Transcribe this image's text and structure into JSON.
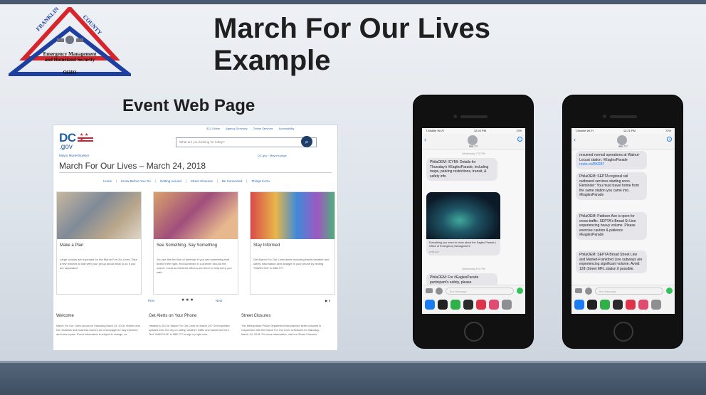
{
  "slide": {
    "title": "March For Our Lives Example",
    "section_label": "Event Web Page"
  },
  "logo": {
    "arc_top": "FRANKLIN",
    "arc_right": "COUNTY",
    "line1": "Emergency Management",
    "line2": "and Homeland Security",
    "state": "OHIO",
    "colors": {
      "red": "#d6262b",
      "blue": "#1f3fa0"
    }
  },
  "web": {
    "brand": "DC",
    "brand_sub": ".gov",
    "top_links": [
      "311 Online",
      "Agency Directory",
      "Online Services",
      "Accessibility"
    ],
    "search_placeholder": "What are you looking for today?",
    "breadcrumb": "Mayor Muriel Bowser",
    "sub_links": "DC.gov  ·  Mayor's page",
    "page_title": "March For Our Lives – March 24, 2018",
    "nav": [
      "Home",
      "Know Before You Go",
      "Getting Around",
      "Street Closures",
      "Be Connected",
      "Things to Do"
    ],
    "cards": [
      {
        "title": "Make a Plan",
        "body": "Large crowds are expected for the March For Our Lives. Take a few minutes to talk with your group about what to do if you are separated."
      },
      {
        "title": "See Something, Say Something",
        "body": "You are the first line of defense! If you see something that doesn't feel right, find someone in a uniform around the march. Local and federal officers are there to help keep you safe."
      },
      {
        "title": "Stay Informed",
        "body": "Get March For Our Lives alerts including timely weather and safety information sent straight to your phone by texting \"MARCH18\" to 888-777."
      }
    ],
    "pager": {
      "prev": "Prev",
      "next": "Next",
      "ctrl": "▶ II"
    },
    "columns": [
      {
        "heading": "Welcome",
        "text": "March For Our Lives occurs on Saturday March 24, 2018. Visitors and DC residents and business owners are encouraged to stay informed and have a plan. Event information is subject to change, so"
      },
      {
        "heading": "Get Alerts on Your Phone",
        "text": "Headed to DC for March For Our Lives on March 24? Get important updates from the city on safety, weather, traffic and transit info here. Text \"MARCH18\" to 888-777 to sign up right now."
      },
      {
        "heading": "Street Closures",
        "text": "The Metropolitan Police Department has planned street closures in conjunction with the March For Our Lives scheduled for Saturday, March 24, 2018. For more information, visit our Street Closures"
      }
    ]
  },
  "phone1": {
    "status_left": "T-Mobile Wi-Fi",
    "status_time": "12:20 PM",
    "status_right": "72%",
    "contact": "888-777",
    "stamp1": "Wednesday 7:32 PM",
    "msg1": "PhilaOEM: ICYMI: Details for Thursday's #EaglesParade, including maps, parking restrictions, transit, & safety info",
    "media_caption": "Everything you need to know about the Eagles Parade | Office of Emergency Management",
    "media_source": "phila.gov",
    "stamp2": "Wednesday 8:01 PM",
    "msg2": "PhilaOEM: For #EaglesParade participant's safety, please",
    "compose_placeholder": "Text Message"
  },
  "phone2": {
    "status_left": "T-Mobile Wi-Fi",
    "status_time": "12:21 PM",
    "status_right": "72%",
    "contact": "888-777",
    "msg0": "resumed normal operations at Walnut-Locust station. #EaglesParade",
    "msg0_link": "route.co/BKR87",
    "msg1": "PhilaOEM: SEPTA regional rail outbound services starting soon. Reminder: You must travel home from the same station you came into. #EaglesParade",
    "msg2": "PhilaOEM: Pattison Ave is open for cross-traffic. SEPTA's Broad St Line experiencing heavy volume. Please exercise caution & patience #EaglesParade",
    "msg3": "PhilaOEM: SEPTA Broad Street Line and Market-Frankford Line subways are experiencing significant volume. Avoid 12th Street MFL station if possible.",
    "compose_placeholder": "Text Message"
  }
}
